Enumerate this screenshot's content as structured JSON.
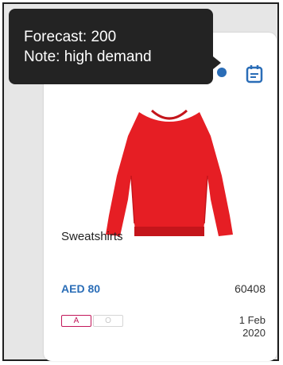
{
  "tooltip": {
    "forecast": "Forecast: 200",
    "note": "Note: high demand"
  },
  "product": {
    "name": "Sweatshirts",
    "price": "AED 80",
    "code": "60408",
    "date_line1": "1 Feb",
    "date_line2": "2020",
    "badges": [
      "A",
      "O"
    ],
    "image_color": "#e61e24"
  },
  "icons": {
    "calendar": "calendar-icon"
  },
  "colors": {
    "accent": "#2a6db7",
    "badge_a": "#c2185b",
    "tooltip_bg": "#232323"
  }
}
